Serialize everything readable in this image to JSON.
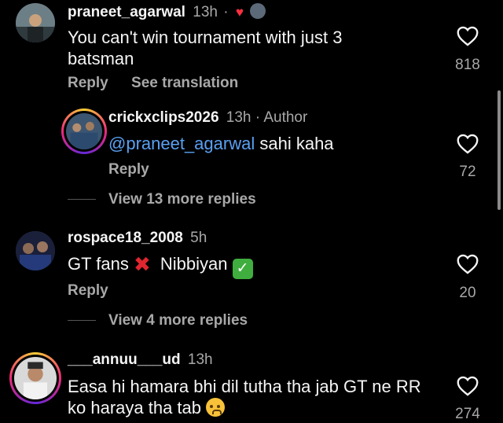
{
  "comments": [
    {
      "username": "praneet_agarwal",
      "time": "13h",
      "separator": "·",
      "text": "You can't win tournament with just 3 batsman",
      "reply_label": "Reply",
      "translate_label": "See translation",
      "likes": "818"
    },
    {
      "username": "crickxclips2026",
      "time": "13h",
      "author_label": "· Author",
      "mention": "@praneet_agarwal",
      "text": "sahi kaha",
      "reply_label": "Reply",
      "likes": "72",
      "view_more": "View 13 more replies"
    },
    {
      "username": "rospace18_2008",
      "time": "5h",
      "text_a": "GT fans",
      "text_b": "Nibbiyan",
      "reply_label": "Reply",
      "likes": "20",
      "view_more": "View 4 more replies"
    },
    {
      "username": "___annuu___ud",
      "time": "13h",
      "text": "Easa hi hamara bhi dil tutha tha jab GT ne RR ko haraya tha tab",
      "likes": "274"
    }
  ],
  "icons": {
    "heart": "heart-outline-icon",
    "liked_by_author": "red-heart-icon",
    "emoji_x": "cross-mark-emoji",
    "emoji_check": "check-mark-button-emoji",
    "emoji_cry": "crying-face-emoji"
  },
  "colors": {
    "background": "#000000",
    "mention": "#5aa0f2",
    "secondary_text": "#a8a8a8",
    "author_heart": "#ff3040"
  }
}
